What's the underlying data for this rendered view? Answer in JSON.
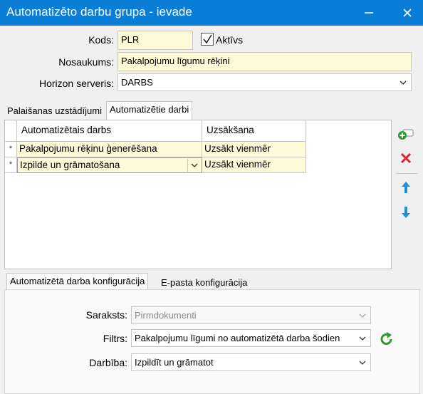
{
  "window": {
    "title": "Automatizēto darbu grupa - ievade",
    "minimize_icon": "minimize-icon",
    "close_icon": "close-icon"
  },
  "form": {
    "code_label": "Kods:",
    "code_value": "PLR",
    "active_label": "Aktīvs",
    "active_checked": true,
    "name_label": "Nosaukums:",
    "name_value": "Pakalpojumu līgumu rēķini",
    "server_label": "Horizon serveris:",
    "server_value": "DARBS"
  },
  "tabs": [
    {
      "label": "Palaišanas uzstādījumi",
      "active": false
    },
    {
      "label": "Automatizētie darbi",
      "active": true
    }
  ],
  "grid": {
    "columns": [
      "Automatizētais darbs",
      "Uzsākšana"
    ],
    "rows": [
      {
        "marker": "*",
        "job": "Pakalpojumu rēķinu ģenerēšana",
        "start": "Uzsākt vienmēr"
      },
      {
        "marker": "*",
        "job": "Izpilde un grāmatošana",
        "start": "Uzsākt vienmēr"
      }
    ]
  },
  "side_actions": [
    {
      "icon": "add-row-icon",
      "color": "#2e9b2e"
    },
    {
      "icon": "delete-icon",
      "color": "#d9262c"
    },
    {
      "icon": "arrow-up-icon",
      "color": "#1e8fd5"
    },
    {
      "icon": "arrow-down-icon",
      "color": "#1e8fd5"
    }
  ],
  "lower_tabs": [
    {
      "label": "Automatizētā darba konfigurācija",
      "active": true
    },
    {
      "label": "E-pasta konfigurācija",
      "active": false
    }
  ],
  "config": {
    "list_label": "Saraksts:",
    "list_value": "Pirmdokumenti",
    "list_disabled": true,
    "filter_label": "Filtrs:",
    "filter_value": "Pakalpojumu līgumi no automatizētā darba šodien",
    "action_label": "Darbība:",
    "action_value": "Izpildīt un grāmatot",
    "refresh_icon": "refresh-icon"
  },
  "colors": {
    "titlebar": "#0a7dd6",
    "required_field": "#fdfad8"
  }
}
